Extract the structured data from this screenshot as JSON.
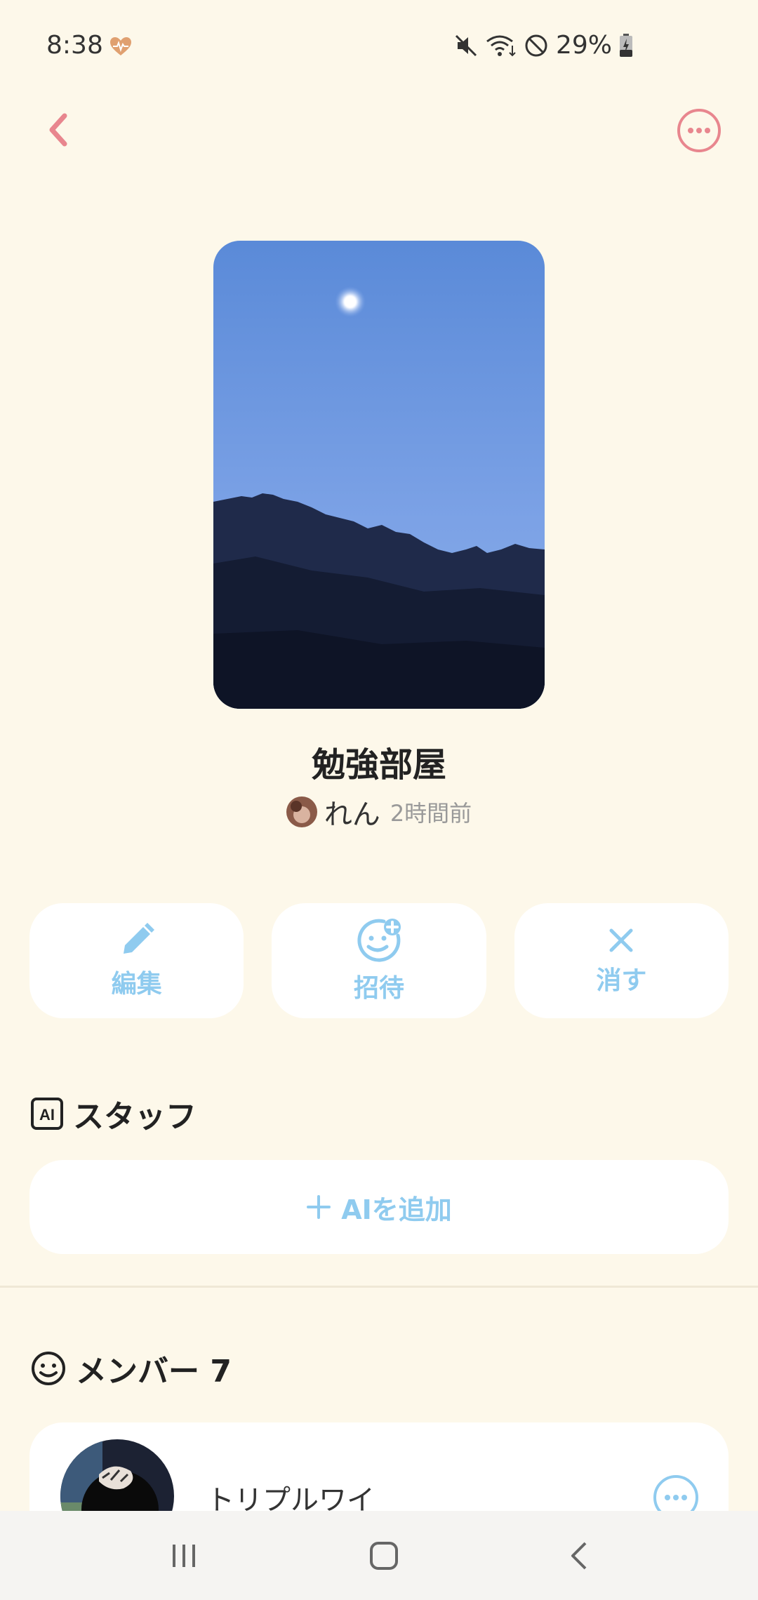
{
  "status": {
    "time": "8:38",
    "battery": "29%"
  },
  "room": {
    "title": "勉強部屋",
    "owner_name": "れん",
    "owner_time": "2時間前"
  },
  "actions": [
    {
      "label": "編集",
      "icon": "pencil-icon"
    },
    {
      "label": "招待",
      "icon": "invite-smile-plus-icon"
    },
    {
      "label": "消す",
      "icon": "close-icon"
    }
  ],
  "staff": {
    "title": "スタッフ",
    "badge": "AI",
    "add_label": "AIを追加"
  },
  "members": {
    "title": "メンバー 7",
    "items": [
      {
        "name": "トリプルワイ"
      }
    ]
  },
  "colors": {
    "background": "#fdf8ea",
    "accent_pink": "#e8868e",
    "accent_blue": "#8fcbef"
  }
}
